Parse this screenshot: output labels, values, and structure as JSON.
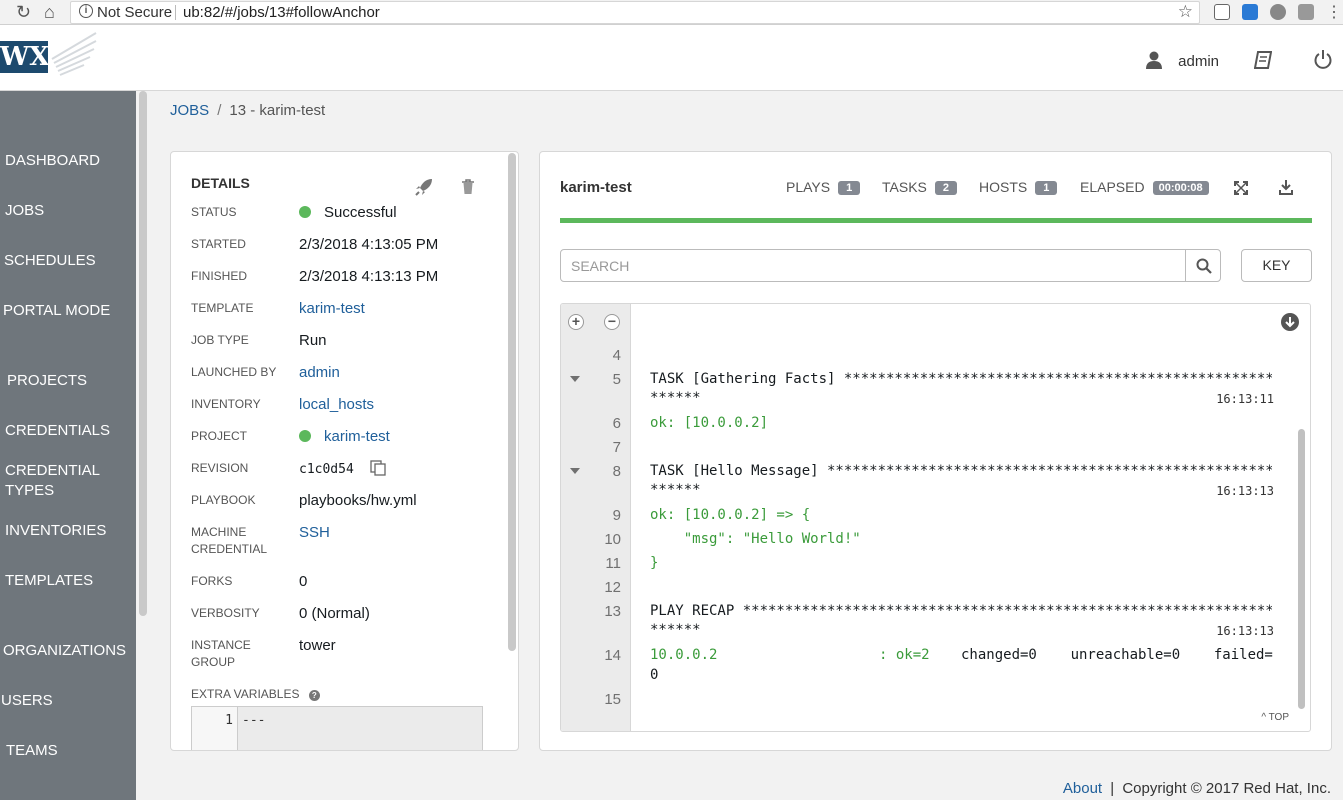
{
  "browser": {
    "security_label": "Not Secure",
    "url": "ub:82/#/jobs/13#followAnchor"
  },
  "header": {
    "logo_text": "WX",
    "user": "admin"
  },
  "sidebar": {
    "items": [
      {
        "label": "DASHBOARD"
      },
      {
        "label": "JOBS"
      },
      {
        "label": "SCHEDULES"
      },
      {
        "label": "PORTAL MODE"
      },
      {
        "label": "PROJECTS"
      },
      {
        "label": "CREDENTIALS"
      },
      {
        "label": "CREDENTIAL TYPES"
      },
      {
        "label": "INVENTORIES"
      },
      {
        "label": "TEMPLATES"
      },
      {
        "label": "ORGANIZATIONS"
      },
      {
        "label": "USERS"
      },
      {
        "label": "TEAMS"
      }
    ]
  },
  "breadcrumb": {
    "root": "JOBS",
    "current": "13 - karim-test"
  },
  "details": {
    "title": "DETAILS",
    "status_label": "STATUS",
    "status": "Successful",
    "started_label": "STARTED",
    "started": "2/3/2018 4:13:05 PM",
    "finished_label": "FINISHED",
    "finished": "2/3/2018 4:13:13 PM",
    "template_label": "TEMPLATE",
    "template": "karim-test",
    "job_type_label": "JOB TYPE",
    "job_type": "Run",
    "launched_by_label": "LAUNCHED BY",
    "launched_by": "admin",
    "inventory_label": "INVENTORY",
    "inventory": "local_hosts",
    "project_label": "PROJECT",
    "project": "karim-test",
    "revision_label": "REVISION",
    "revision": "c1c0d54",
    "playbook_label": "PLAYBOOK",
    "playbook": "playbooks/hw.yml",
    "machine_credential_label_1": "MACHINE",
    "machine_credential_label_2": "CREDENTIAL",
    "machine_credential": "SSH",
    "forks_label": "FORKS",
    "forks": "0",
    "verbosity_label": "VERBOSITY",
    "verbosity": "0 (Normal)",
    "instance_group_label_1": "INSTANCE",
    "instance_group_label_2": "GROUP",
    "instance_group": "tower",
    "extra_variables_label": "EXTRA VARIABLES",
    "extra_line_number": "1",
    "extra_code": "---",
    "status_color": "#5cb85c"
  },
  "output": {
    "job_name": "karim-test",
    "plays_label": "PLAYS",
    "plays": "1",
    "tasks_label": "TASKS",
    "tasks": "2",
    "hosts_label": "HOSTS",
    "hosts": "1",
    "elapsed_label": "ELAPSED",
    "elapsed": "00:00:08",
    "search_placeholder": "SEARCH",
    "key_label": "KEY",
    "top_label": "^ TOP",
    "progress_percent": 100,
    "lines": [
      {
        "n": "4",
        "text": ""
      },
      {
        "n": "5",
        "text": "TASK [Gathering Facts] ******************************************************",
        "cont": "******",
        "ts": "16:13:11"
      },
      {
        "n": "6",
        "text": "ok: [10.0.0.2]"
      },
      {
        "n": "7",
        "text": ""
      },
      {
        "n": "8",
        "text": "TASK [Hello Message] ********************************************************",
        "cont": "******",
        "ts": "16:13:13"
      },
      {
        "n": "9",
        "text": "ok: [10.0.0.2] => {"
      },
      {
        "n": "10",
        "text": "    \"msg\": \"Hello World!\""
      },
      {
        "n": "11",
        "text": "}"
      },
      {
        "n": "12",
        "text": ""
      },
      {
        "n": "13",
        "text": "PLAY RECAP ******************************************************************",
        "cont": "******",
        "ts": "16:13:13"
      },
      {
        "n": "14",
        "text_a": "10.0.0.2",
        "text_b": ": ok=2",
        "text_c": "changed=0    unreachable=0    failed=",
        "cont": "0"
      },
      {
        "n": "15",
        "text": ""
      }
    ]
  },
  "footer": {
    "about": "About",
    "separator": "|",
    "copyright": "Copyright © 2017 Red Hat, Inc."
  }
}
